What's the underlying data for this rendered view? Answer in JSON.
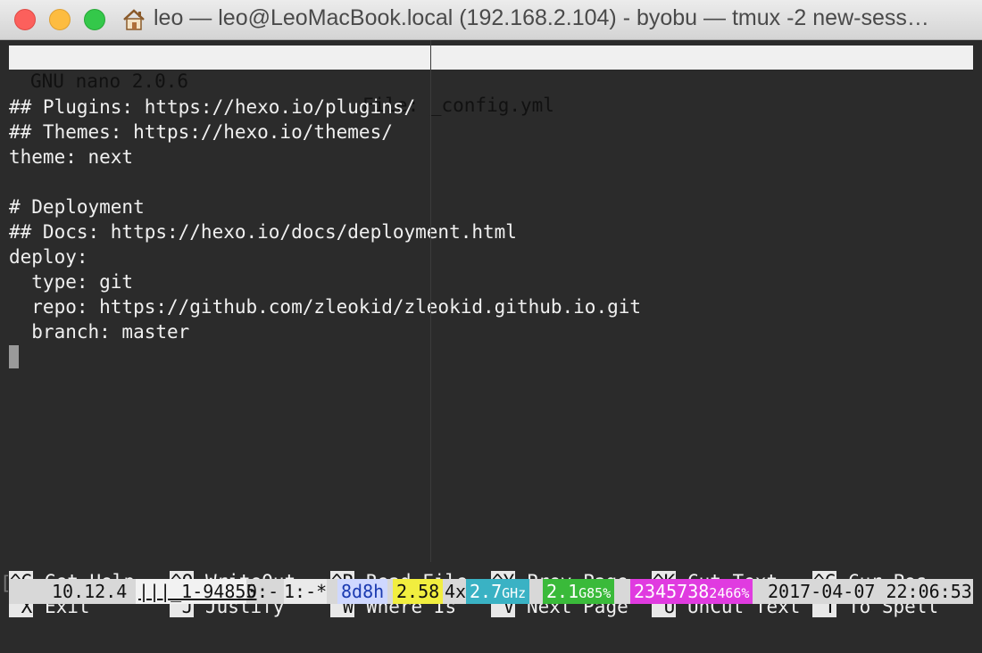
{
  "window": {
    "title": "leo — leo@LeoMacBook.local (192.168.2.104) - byobu — tmux -2 new-sess…",
    "icon": "home-icon"
  },
  "nano": {
    "app": "GNU nano 2.0.6",
    "file_label": "File: _config.yml"
  },
  "lines": [
    "",
    "## Plugins: https://hexo.io/plugins/",
    "## Themes: https://hexo.io/themes/",
    "theme: next",
    "",
    "# Deployment",
    "## Docs: https://hexo.io/docs/deployment.html",
    "deploy:",
    "  type: git",
    "  repo: https://github.com/zleokid/zleokid.github.io.git",
    "  branch: master"
  ],
  "shortcuts": [
    {
      "key": "^G",
      "label": "Get Help"
    },
    {
      "key": "^O",
      "label": "WriteOut"
    },
    {
      "key": "^R",
      "label": "Read File"
    },
    {
      "key": "^Y",
      "label": "Prev Page"
    },
    {
      "key": "^K",
      "label": "Cut Text"
    },
    {
      "key": "^C",
      "label": "Cur Pos"
    },
    {
      "key": "^X",
      "label": "Exit"
    },
    {
      "key": "^J",
      "label": "Justify"
    },
    {
      "key": "^W",
      "label": "Where Is"
    },
    {
      "key": "^V",
      "label": "Next Page"
    },
    {
      "key": "^U",
      "label": "UnCut Text"
    },
    {
      "key": "^T",
      "label": "To Spell"
    }
  ],
  "bracket": "[",
  "status": {
    "apple_glyph": "",
    "os_version": "10.12.4",
    "session": "|||_1-94855",
    "window0": "0:-",
    "window1": "1:-*",
    "hash": "8d8h",
    "load": "2.58",
    "cpu_count": "4x",
    "cpu_freq": "2.7",
    "cpu_unit": "GHz",
    "mem": "2.1",
    "mem_unit": "G",
    "mem_pct": "85%",
    "disk": "2345738",
    "disk_tail": "2466%",
    "datetime": "2017-04-07 22:06:53"
  }
}
